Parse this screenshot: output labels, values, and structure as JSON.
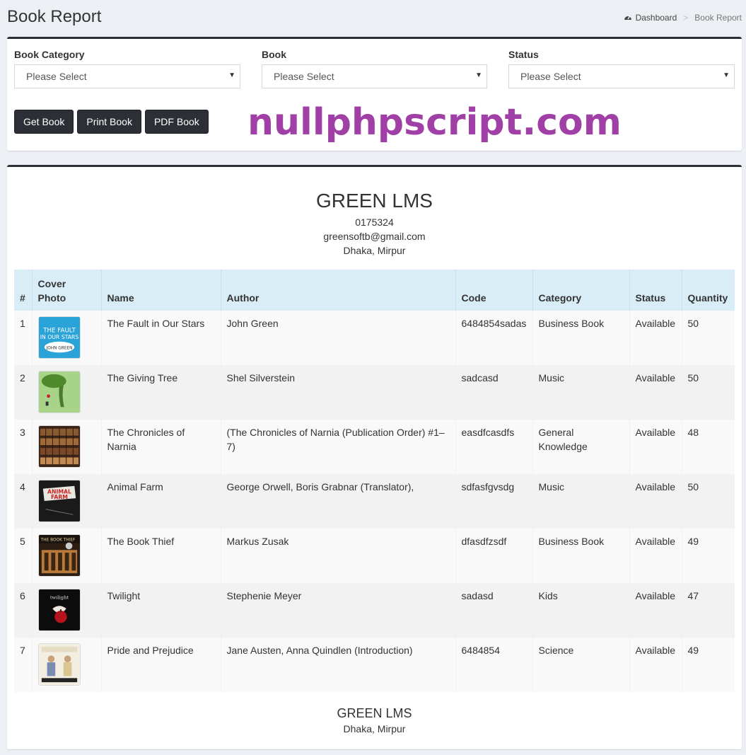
{
  "page": {
    "title": "Book Report",
    "breadcrumb": {
      "home": "Dashboard",
      "current": "Book Report",
      "home_icon": "dashboard-icon"
    }
  },
  "filters": {
    "category": {
      "label": "Book Category",
      "value": "Please Select"
    },
    "book": {
      "label": "Book",
      "value": "Please Select"
    },
    "status": {
      "label": "Status",
      "value": "Please Select"
    }
  },
  "buttons": {
    "get": "Get Book",
    "print": "Print Book",
    "pdf": "PDF Book"
  },
  "watermark": "nullphpscript.com",
  "report": {
    "company": "GREEN LMS",
    "phone": "0175324",
    "email": "greensoftb@gmail.com",
    "address": "Dhaka, Mirpur",
    "columns": [
      "#",
      "Cover Photo",
      "Name",
      "Author",
      "Code",
      "Category",
      "Status",
      "Quantity"
    ],
    "rows": [
      {
        "no": "1",
        "name": "The Fault in Our Stars",
        "author": "John Green",
        "code": "6484854sadas",
        "category": "Business Book",
        "status": "Available",
        "quantity": "50",
        "cover_icon": "book-cover-fault-in-our-stars"
      },
      {
        "no": "2",
        "name": "The Giving Tree",
        "author": "Shel Silverstein",
        "code": "sadcasd",
        "category": "Music",
        "status": "Available",
        "quantity": "50",
        "cover_icon": "book-cover-giving-tree"
      },
      {
        "no": "3",
        "name": "The Chronicles of Narnia",
        "author": "(The Chronicles of Narnia (Publication Order) #1–7)",
        "code": "easdfcasdfs",
        "category": "General Knowledge",
        "status": "Available",
        "quantity": "48",
        "cover_icon": "book-cover-narnia"
      },
      {
        "no": "4",
        "name": "Animal Farm",
        "author": "George Orwell, Boris Grabnar (Translator),",
        "code": "sdfasfgvsdg",
        "category": "Music",
        "status": "Available",
        "quantity": "50",
        "cover_icon": "book-cover-animal-farm"
      },
      {
        "no": "5",
        "name": "The Book Thief",
        "author": "Markus Zusak",
        "code": "dfasdfzsdf",
        "category": "Business Book",
        "status": "Available",
        "quantity": "49",
        "cover_icon": "book-cover-book-thief"
      },
      {
        "no": "6",
        "name": "Twilight",
        "author": "Stephenie Meyer",
        "code": "sadasd",
        "category": "Kids",
        "status": "Available",
        "quantity": "47",
        "cover_icon": "book-cover-twilight"
      },
      {
        "no": "7",
        "name": "Pride and Prejudice",
        "author": "Jane Austen, Anna Quindlen (Introduction)",
        "code": "6484854",
        "category": "Science",
        "status": "Available",
        "quantity": "49",
        "cover_icon": "book-cover-pride-and-prejudice"
      }
    ],
    "footer": {
      "name": "GREEN LMS",
      "address": "Dhaka, Mirpur"
    }
  }
}
